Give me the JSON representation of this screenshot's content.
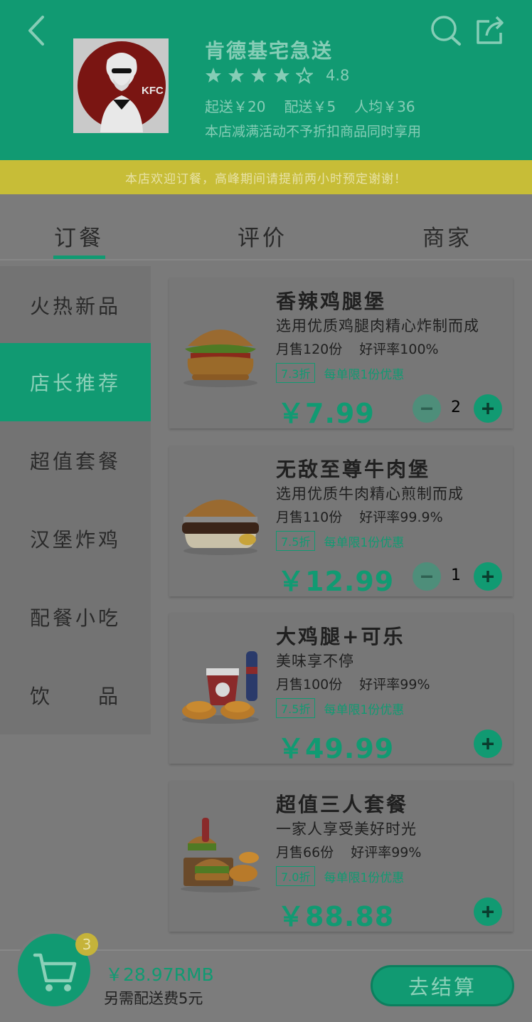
{
  "header": {
    "shop_name": "肯德基宅急送",
    "rating": "4.8",
    "min_order": "起送￥20",
    "delivery_fee": "配送￥5",
    "per_person": "人均￥36",
    "promo_notice": "本店减满活动不予折扣商品同时享用",
    "logo_text": "KFC"
  },
  "notice_bar": "本店欢迎订餐，高峰期间请提前两小时预定谢谢！",
  "tabs": [
    {
      "label": "订餐"
    },
    {
      "label": "评价"
    },
    {
      "label": "商家"
    }
  ],
  "sidebar": [
    {
      "label": "火热新品"
    },
    {
      "label": "店长推荐"
    },
    {
      "label": "超值套餐"
    },
    {
      "label": "汉堡炸鸡"
    },
    {
      "label": "配餐小吃"
    },
    {
      "label": "饮　　品"
    }
  ],
  "products": [
    {
      "title": "香辣鸡腿堡",
      "desc": "选用优质鸡腿肉精心炸制而成",
      "sales": "月售120份",
      "rating": "好评率100%",
      "discount": "7.3折",
      "promo": "每单限1份优惠",
      "price": "￥7.99",
      "qty": "2"
    },
    {
      "title": "无敌至尊牛肉堡",
      "desc": "选用优质牛肉精心煎制而成",
      "sales": "月售110份",
      "rating": "好评率99.9%",
      "discount": "7.5折",
      "promo": "每单限1份优惠",
      "price": "￥12.99",
      "qty": "1"
    },
    {
      "title": "大鸡腿+可乐",
      "desc": "美味享不停",
      "sales": "月售100份",
      "rating": "好评率99%",
      "discount": "7.5折",
      "promo": "每单限1份优惠",
      "price": "￥49.99"
    },
    {
      "title": "超值三人套餐",
      "desc": "一家人享受美好时光",
      "sales": "月售66份",
      "rating": "好评率99%",
      "discount": "7.0折",
      "promo": "每单限1份优惠",
      "price": "￥88.88"
    }
  ],
  "cart": {
    "badge": "3",
    "total": "￥28.97RMB",
    "delivery_note": "另需配送费5元",
    "checkout_label": "去结算"
  },
  "colors": {
    "brand_green": "#119a72",
    "notice_yellow": "#c7bd37"
  }
}
